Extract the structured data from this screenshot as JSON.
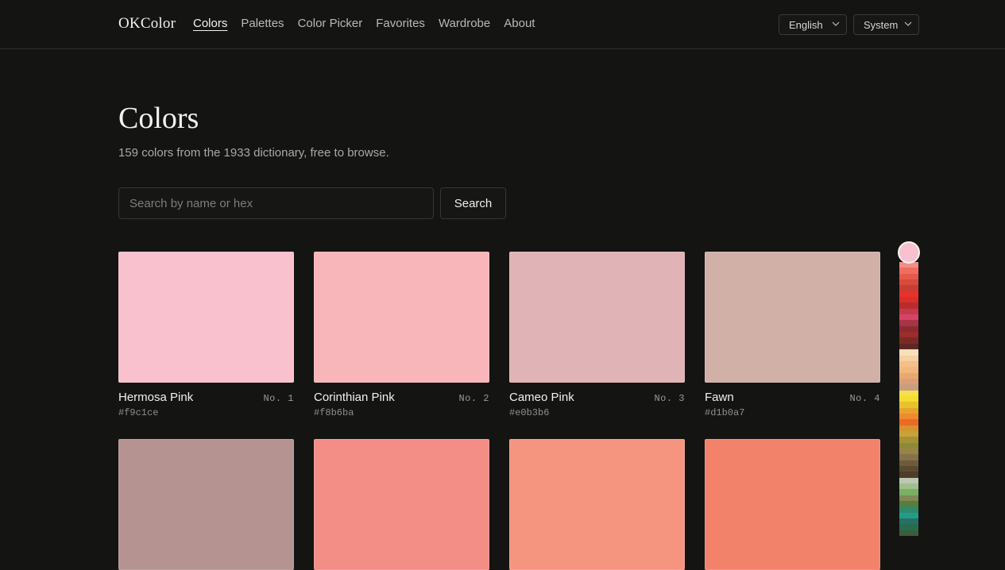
{
  "header": {
    "logo": "OKColor",
    "nav": [
      {
        "label": "Colors",
        "active": true
      },
      {
        "label": "Palettes"
      },
      {
        "label": "Color Picker"
      },
      {
        "label": "Favorites"
      },
      {
        "label": "Wardrobe"
      },
      {
        "label": "About"
      }
    ],
    "language": "English",
    "theme": "System"
  },
  "main": {
    "title": "Colors",
    "subtitle": "159 colors from the 1933 dictionary, free to browse.",
    "search": {
      "placeholder": "Search by name or hex",
      "value": "",
      "button_label": "Search"
    },
    "colors": [
      {
        "name": "Hermosa Pink",
        "number": "No. 1",
        "hex": "#f9c1ce"
      },
      {
        "name": "Corinthian Pink",
        "number": "No. 2",
        "hex": "#f8b6ba"
      },
      {
        "name": "Cameo Pink",
        "number": "No. 3",
        "hex": "#e0b3b6"
      },
      {
        "name": "Fawn",
        "number": "No. 4",
        "hex": "#d1b0a7"
      },
      {
        "name": "",
        "number": "",
        "hex": "",
        "swatch": "#b49390"
      },
      {
        "name": "",
        "number": "",
        "hex": "",
        "swatch": "#f28e85"
      },
      {
        "name": "",
        "number": "",
        "hex": "",
        "swatch": "#f59580"
      },
      {
        "name": "",
        "number": "",
        "hex": "",
        "swatch": "#f3826b"
      }
    ]
  },
  "color_strip": {
    "selected_swatch": "#f9c1ce",
    "swatches": [
      "#f28e85",
      "#ee6f62",
      "#e65a4a",
      "#d84a3c",
      "#c93e34",
      "#e8322c",
      "#d9302a",
      "#b82d2c",
      "#c43a4f",
      "#d84365",
      "#a83447",
      "#8c2a33",
      "#9b2d2a",
      "#7a2a25",
      "#602625",
      "#f7e0b8",
      "#f6cfa2",
      "#f5be8a",
      "#f2b77c",
      "#e9a86f",
      "#d9a078",
      "#c99d80",
      "#f4e04d",
      "#f5dc30",
      "#e8c22c",
      "#e6a42f",
      "#ef8a2e",
      "#e96b26",
      "#d5942f",
      "#c8a23b",
      "#a69234",
      "#8c8a3a",
      "#9b8245",
      "#86714b",
      "#6d5b3c",
      "#5b4a32",
      "#4f3c28",
      "#b9c9b4",
      "#9fbf8c",
      "#7ab063",
      "#7f8a55",
      "#5c7a3c",
      "#2e8a6a",
      "#1f9d8a",
      "#2a6f63",
      "#276b50",
      "#3c5d3a"
    ]
  }
}
